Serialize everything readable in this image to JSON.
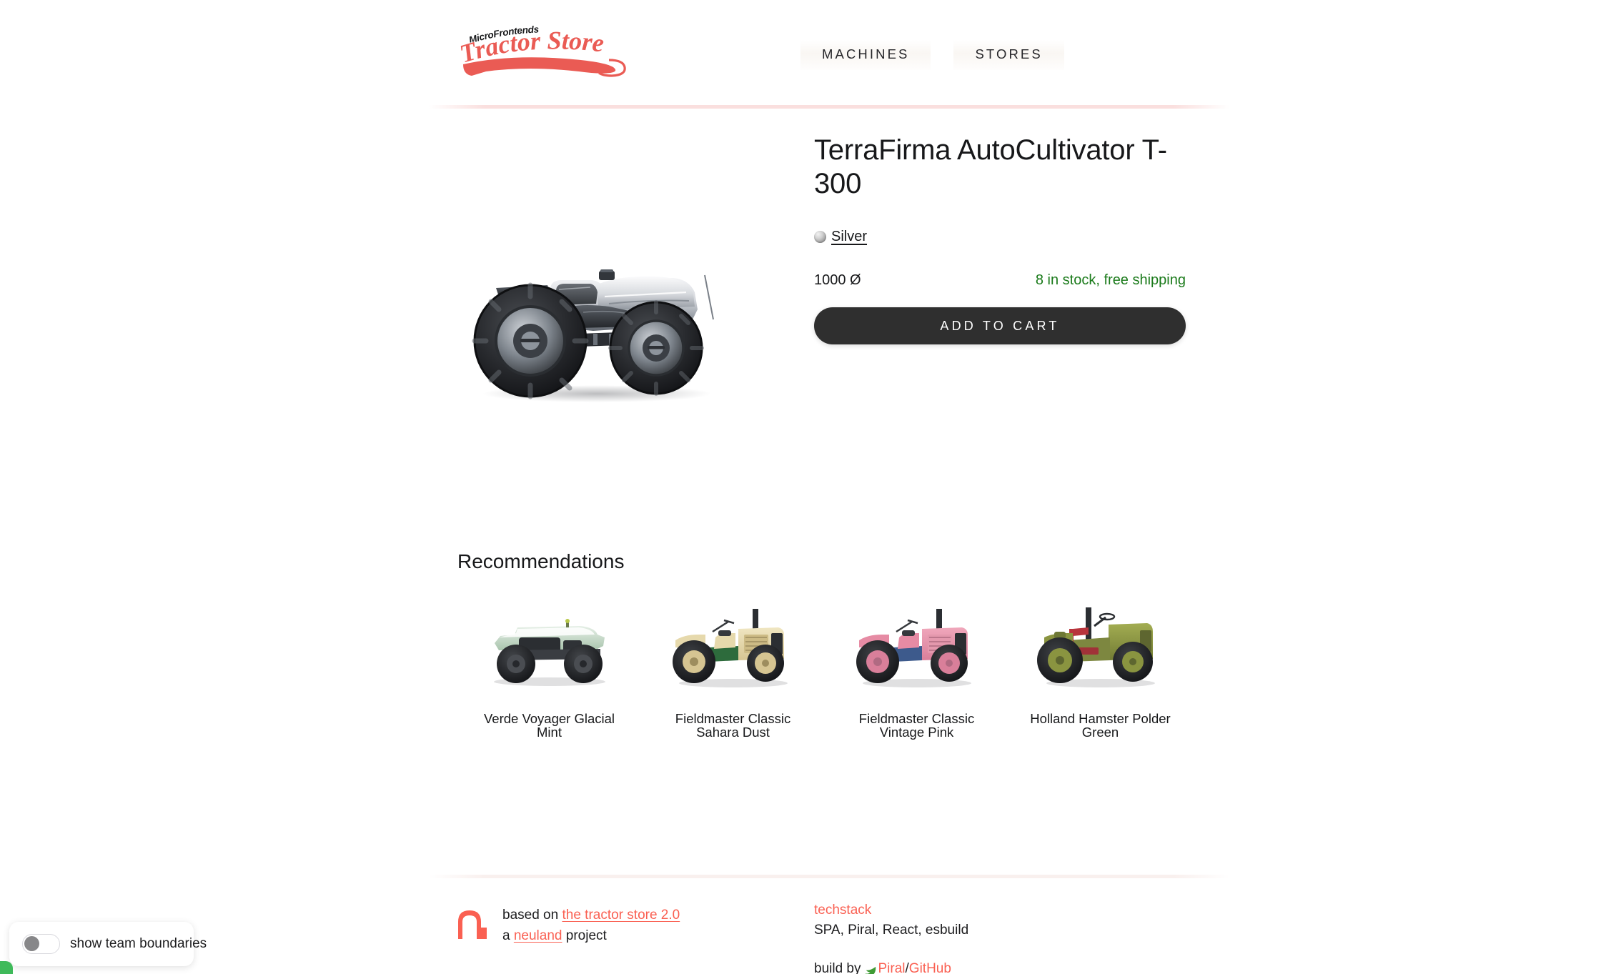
{
  "header": {
    "logo_top": "MicroFrontends",
    "logo_main": "Tractor Store",
    "nav": [
      {
        "label": "MACHINES",
        "name": "machines"
      },
      {
        "label": "STORES",
        "name": "stores"
      }
    ]
  },
  "product": {
    "title": "TerraFirma AutoCultivator T-300",
    "variant_label": "Silver",
    "variant_color": "#b8b8b8",
    "price": "1000 Ø",
    "stock": "8 in stock, free shipping",
    "stock_color": "#1a7a1a",
    "add_to_cart_label": "ADD TO CART",
    "image_alt": "silver futuristic tractor"
  },
  "recommendations": {
    "title": "Recommendations",
    "items": [
      {
        "name": "Verde Voyager Glacial Mint",
        "body": "#cfe3d2",
        "accent": "#ffffff",
        "style": "modern"
      },
      {
        "name": "Fieldmaster Classic Sahara Dust",
        "body": "#e6d9ac",
        "accent": "#2d6b3c",
        "style": "classic"
      },
      {
        "name": "Fieldmaster Classic Vintage Pink",
        "body": "#e68ba4",
        "accent": "#3d5a8c",
        "style": "classic"
      },
      {
        "name": "Holland Hamster Polder Green",
        "body": "#8a9440",
        "accent": "#b8343c",
        "style": "classic"
      }
    ]
  },
  "footer": {
    "based_on_prefix": "based on ",
    "based_on_link": "the tractor store 2.0",
    "project_prefix": "a ",
    "project_link": "neuland",
    "project_suffix": " project",
    "techstack_heading": "techstack",
    "techstack_value": "SPA, Piral, React, esbuild",
    "build_by_prefix": "build by ",
    "build_by_link1": "Piral",
    "build_by_separator": " / ",
    "build_by_link2": "GitHub",
    "accent_color": "#fa6052"
  },
  "team_boundaries": {
    "label": "show team boundaries",
    "enabled": false
  }
}
